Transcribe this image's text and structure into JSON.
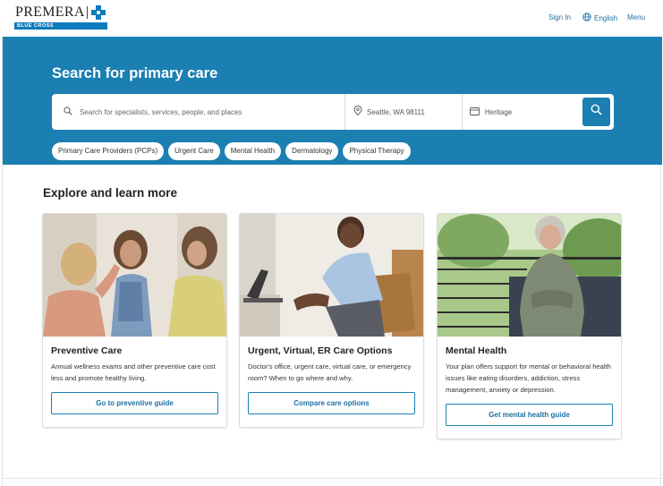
{
  "brand": {
    "name": "PREMERA",
    "sub": "BLUE CROSS"
  },
  "header": {
    "sign_in": "Sign In",
    "language": "English",
    "menu": "Menu"
  },
  "hero": {
    "title": "Search for primary care",
    "search": {
      "query_placeholder": "Search for specialists, services, people, and places",
      "location_value": "Seattle, WA 98111",
      "plan_value": "Heritage"
    },
    "chips": [
      {
        "label": "Primary Care Providers (PCPs)"
      },
      {
        "label": "Urgent Care"
      },
      {
        "label": "Mental Health"
      },
      {
        "label": "Dermatology"
      },
      {
        "label": "Physical Therapy"
      }
    ]
  },
  "explore": {
    "title": "Explore and learn more",
    "cards": [
      {
        "title": "Preventive Care",
        "description": "Annual wellness exams and other preventive care cost less and promote healthy living.",
        "cta": "Go to preventive guide"
      },
      {
        "title": "Urgent, Virtual, ER Care Options",
        "description": "Doctor's office, urgent care, virtual care, or emergency room? When to go where and why.",
        "cta": "Compare care options"
      },
      {
        "title": "Mental Health",
        "description": "Your plan offers support for mental or behavioral health issues like eating disorders, addiction, stress management, anxiety or depression.",
        "cta": "Get mental health guide"
      }
    ]
  },
  "colors": {
    "brand_blue": "#1b7fb1",
    "link_blue": "#1d6fa5"
  },
  "icons": {
    "search": "search-icon",
    "location": "location-pin-icon",
    "plan": "card-icon",
    "globe": "globe-icon"
  }
}
